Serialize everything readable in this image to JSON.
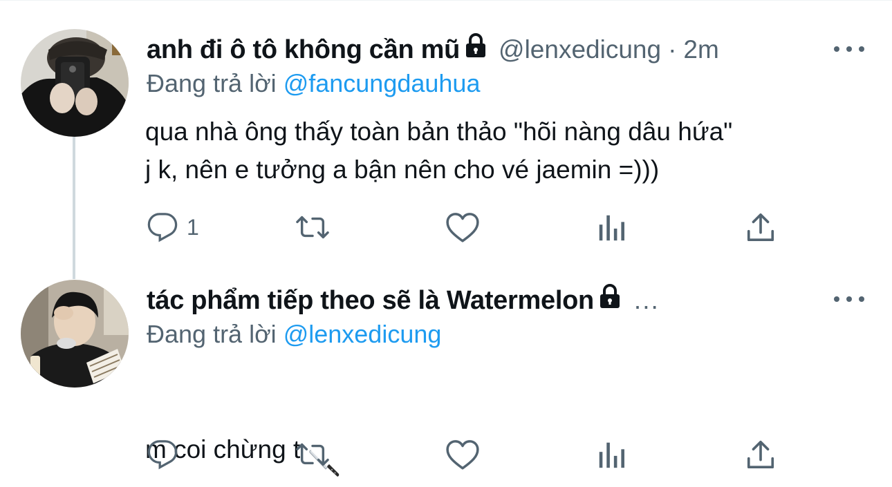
{
  "tweets": [
    {
      "display_name": "anh đi ô tô không cần mũ",
      "handle": "@lenxedicung",
      "separator": "·",
      "time": "2m",
      "reply_prefix": "Đang trả lời",
      "reply_to": "@fancungdauhua",
      "text": "qua nhà ông thấy toàn bản thảo \"hõi nàng dâu hứa\"\nj k, nên e tưởng a bận nên cho vé jaemin =)))",
      "reply_count": "1",
      "locked": true
    },
    {
      "display_name": "tác phẩm tiếp theo sẽ là Watermelon",
      "handle_truncated": "...",
      "reply_prefix": "Đang trả lời",
      "reply_to": "@lenxedicung",
      "text": "m coi chừng t",
      "emoji": "knife-icon",
      "reply_count": "",
      "locked": true
    }
  ],
  "icons": {
    "reply": "reply-icon",
    "retweet": "retweet-icon",
    "like": "like-icon",
    "views": "views-icon",
    "share": "share-icon",
    "more": "more-icon",
    "lock": "lock-icon"
  },
  "colors": {
    "text_primary": "#0f1419",
    "text_secondary": "#536471",
    "link": "#1d9bf0",
    "thread_line": "#cfd9de"
  }
}
